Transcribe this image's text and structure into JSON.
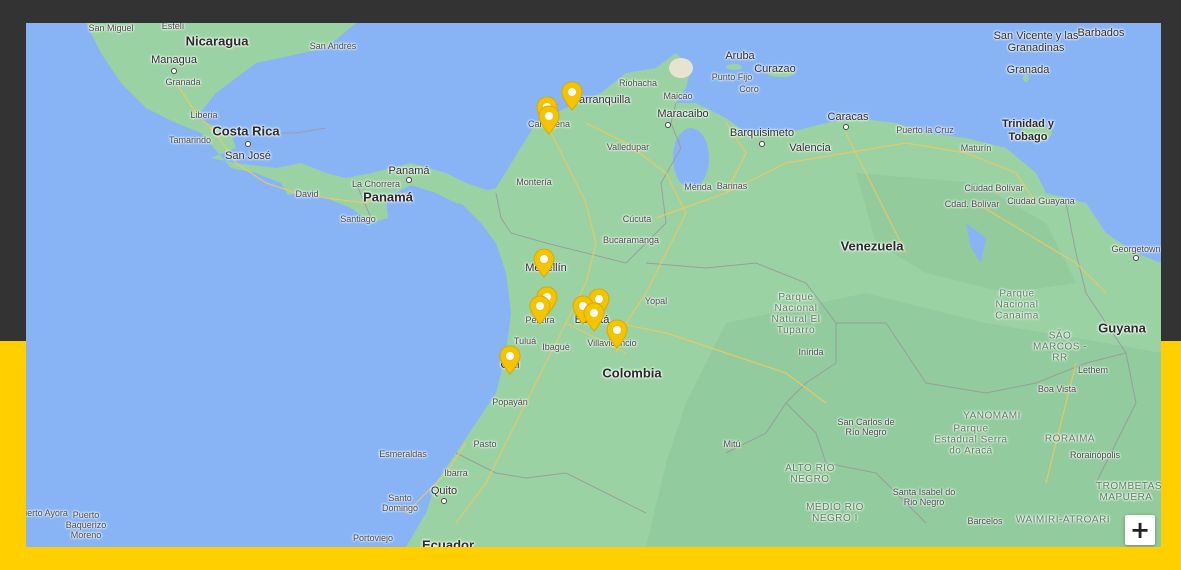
{
  "colors": {
    "frame_dark": "#333333",
    "frame_accent": "#ffcf00",
    "water": "#88b4f5",
    "land": "#9bd2a4",
    "marker": "#f5c400"
  },
  "map": {
    "countries": [
      {
        "name": "Nicaragua"
      },
      {
        "name": "Costa Rica"
      },
      {
        "name": "Panamá"
      },
      {
        "name": "Venezuela"
      },
      {
        "name": "Colombia"
      },
      {
        "name": "Guyana"
      },
      {
        "name": "Ecuador"
      },
      {
        "name": "Trinidad y Tobago"
      }
    ],
    "cities": [
      {
        "name": "San Miguel"
      },
      {
        "name": "Estelí"
      },
      {
        "name": "Managua"
      },
      {
        "name": "Granada"
      },
      {
        "name": "San Andrés"
      },
      {
        "name": "Liberia"
      },
      {
        "name": "Tamarindo"
      },
      {
        "name": "San José"
      },
      {
        "name": "David"
      },
      {
        "name": "La Chorrera"
      },
      {
        "name": "Panamá"
      },
      {
        "name": "Santiago"
      },
      {
        "name": "Aruba"
      },
      {
        "name": "Curazao"
      },
      {
        "name": "Punto Fijo"
      },
      {
        "name": "Coro"
      },
      {
        "name": "Riohacha"
      },
      {
        "name": "Maicao"
      },
      {
        "name": "Barranquilla"
      },
      {
        "name": "Cartagena"
      },
      {
        "name": "Valledupar"
      },
      {
        "name": "Maracaibo"
      },
      {
        "name": "Barquisimeto"
      },
      {
        "name": "Valencia"
      },
      {
        "name": "Caracas"
      },
      {
        "name": "Puerto la Cruz"
      },
      {
        "name": "Maturín"
      },
      {
        "name": "Montería"
      },
      {
        "name": "Mérida"
      },
      {
        "name": "Barinas"
      },
      {
        "name": "Cúcuta"
      },
      {
        "name": "Bucaramanga"
      },
      {
        "name": "Medellín"
      },
      {
        "name": "Yopal"
      },
      {
        "name": "Pereira"
      },
      {
        "name": "Bogotá"
      },
      {
        "name": "Tuluá"
      },
      {
        "name": "Ibagué"
      },
      {
        "name": "Villavicencio"
      },
      {
        "name": "Cali"
      },
      {
        "name": "Popayán"
      },
      {
        "name": "Pasto"
      },
      {
        "name": "Esmeraldas"
      },
      {
        "name": "Ibarra"
      },
      {
        "name": "Quito"
      },
      {
        "name": "Santo Domingo"
      },
      {
        "name": "Portoviejo"
      },
      {
        "name": "Puerto Ayora"
      },
      {
        "name": "Puerto Baquerizo Moreno"
      },
      {
        "name": "Ciudad Bolívar"
      },
      {
        "name": "Cdad. Bolívar"
      },
      {
        "name": "Ciudad Guayana"
      },
      {
        "name": "Georgetown"
      },
      {
        "name": "Inírida"
      },
      {
        "name": "San Carlos de Río Negro"
      },
      {
        "name": "Mitú"
      },
      {
        "name": "Lethem"
      },
      {
        "name": "Boa Vista"
      },
      {
        "name": "Rorainópolis"
      },
      {
        "name": "Santa Isabel do Rio Negro"
      },
      {
        "name": "Barcelos"
      },
      {
        "name": "Granada"
      },
      {
        "name": "Barbados"
      },
      {
        "name": "San Vicente y las Granadinas"
      }
    ],
    "regions": [
      {
        "name": "Parque Nacional Natural El Tuparro"
      },
      {
        "name": "Parque Nacional Canaima"
      },
      {
        "name": "Parque Estadual Serra do Aracá"
      },
      {
        "name": "ALTO RIO NEGRO"
      },
      {
        "name": "MÉDIO RIO NEGRO I"
      },
      {
        "name": "YANOMAMI"
      },
      {
        "name": "RORAIMA"
      },
      {
        "name": "SÃO MARCOS - RR"
      },
      {
        "name": "WAIMIRI-ATROARI"
      },
      {
        "name": "TROMBETAS/ MAPUERA"
      }
    ],
    "markers": [
      {
        "name": "marker-barranquilla"
      },
      {
        "name": "marker-cartagena-1"
      },
      {
        "name": "marker-cartagena-2"
      },
      {
        "name": "marker-medellin"
      },
      {
        "name": "marker-pereira-1"
      },
      {
        "name": "marker-pereira-2"
      },
      {
        "name": "marker-bogota-1"
      },
      {
        "name": "marker-bogota-2"
      },
      {
        "name": "marker-bogota-3"
      },
      {
        "name": "marker-villavicencio"
      },
      {
        "name": "marker-cali"
      }
    ],
    "zoom_in_label": "+"
  }
}
